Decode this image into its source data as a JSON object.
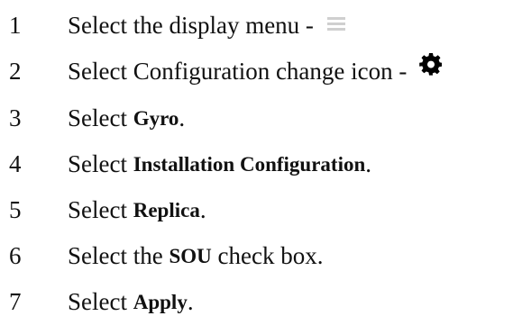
{
  "steps": [
    {
      "number": "1",
      "prefix": "Select the display menu - ",
      "icon": "menu-icon"
    },
    {
      "number": "2",
      "prefix": "Select Configuration change icon - ",
      "icon": "gear-icon"
    },
    {
      "number": "3",
      "prefix": "Select ",
      "bold": "Gyro",
      "suffix": "."
    },
    {
      "number": "4",
      "prefix": "Select ",
      "bold": "Installation Configuration",
      "suffix": "."
    },
    {
      "number": "5",
      "prefix": "Select ",
      "bold": "Replica",
      "suffix": "."
    },
    {
      "number": "6",
      "prefix": "Select the ",
      "bold": "SOU",
      "suffix": " check box."
    },
    {
      "number": "7",
      "prefix": "Select ",
      "bold": "Apply",
      "suffix": "."
    }
  ],
  "colors": {
    "text": "#111111",
    "menu_icon": "#cfcfcf",
    "gear_icon": "#000000"
  }
}
